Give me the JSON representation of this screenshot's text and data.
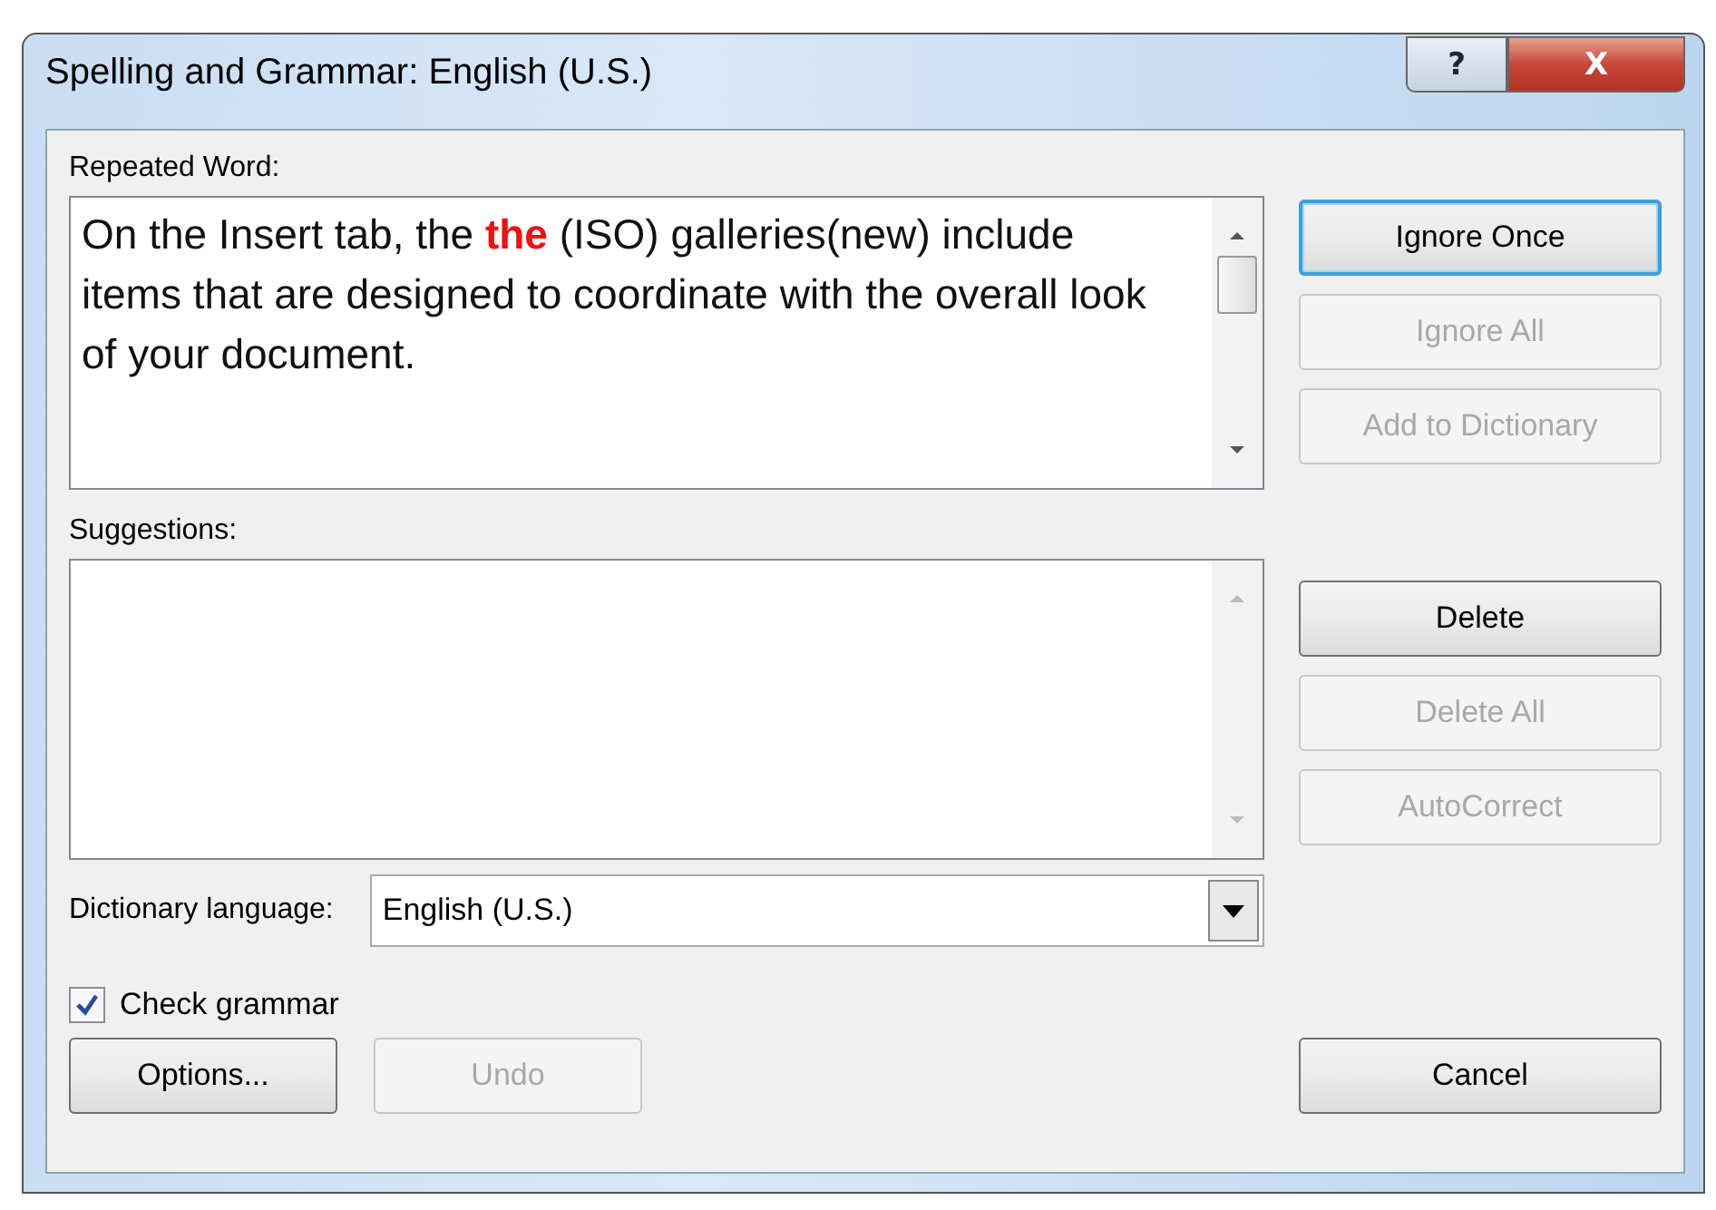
{
  "window": {
    "title": "Spelling and Grammar: English (U.S.)",
    "help_button": "?",
    "close_button": "X"
  },
  "repeated_word": {
    "label": "Repeated Word:",
    "parts": [
      {
        "text": "On the Insert tab, the ",
        "flagged": false
      },
      {
        "text": "the",
        "flagged": true
      },
      {
        "text": " (ISO) galleries(new) include items that are designed to coordinate with the overall look of your document.",
        "flagged": false
      }
    ]
  },
  "top_buttons": [
    {
      "label": "Ignore Once",
      "disabled": false,
      "default": true
    },
    {
      "label": "Ignore All",
      "disabled": true,
      "default": false
    },
    {
      "label": "Add to Dictionary",
      "disabled": true,
      "default": false
    }
  ],
  "suggestions": {
    "label": "Suggestions:"
  },
  "suggestion_buttons": [
    {
      "label": "Delete",
      "disabled": false,
      "default": false
    },
    {
      "label": "Delete All",
      "disabled": true,
      "default": false
    },
    {
      "label": "AutoCorrect",
      "disabled": true,
      "default": false
    }
  ],
  "dictionary_language": {
    "label": "Dictionary language:",
    "value": "English (U.S.)"
  },
  "check_grammar": {
    "label": "Check grammar",
    "checked": true
  },
  "bottom_buttons": [
    {
      "label": "Options...",
      "disabled": false,
      "default": false
    },
    {
      "label": "Undo",
      "disabled": true,
      "default": false
    }
  ],
  "cancel_button": {
    "label": "Cancel",
    "disabled": false,
    "default": false
  }
}
